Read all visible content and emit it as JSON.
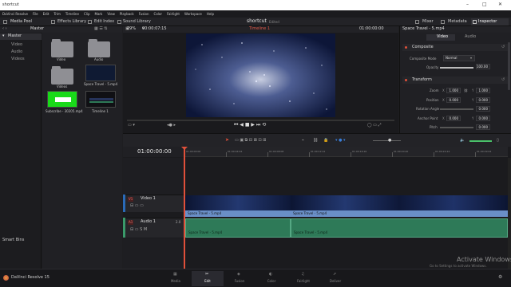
{
  "window": {
    "title": "shortcut"
  },
  "menu": [
    "DaVinci Resolve",
    "File",
    "Edit",
    "Trim",
    "Timeline",
    "Clip",
    "Mark",
    "View",
    "Playback",
    "Fusion",
    "Color",
    "Fairlight",
    "Workspace",
    "Help"
  ],
  "toolbar": {
    "media_pool": "Media Pool",
    "effects_library": "Effects Library",
    "edit_index": "Edit Index",
    "sound_library": "Sound Library",
    "project": "shortcut",
    "project_status": "Edited",
    "mixer": "Mixer",
    "metadata": "Metadata",
    "inspector": "Inspector"
  },
  "sidebar": {
    "items": [
      "Master",
      "Video",
      "Audio",
      "Videos"
    ],
    "smart_bins": "Smart Bins",
    "bin_header": "Master"
  },
  "media": [
    {
      "label": "Video"
    },
    {
      "label": "Audio"
    },
    {
      "label": "Videos"
    },
    {
      "label": "Space Travel - 5.mp4"
    },
    {
      "label": "Subscribe - 30205.mp4"
    },
    {
      "label": "Timeline 1"
    }
  ],
  "viewer": {
    "zoom": "29%",
    "timecode_left": "00:00:07:15",
    "timeline_name": "Timeline 1",
    "timecode_right": "01:00:00:00"
  },
  "inspector": {
    "clip_name": "Space Travel - 5.mp4",
    "tab_video": "Video",
    "tab_audio": "Audio",
    "composite": {
      "title": "Composite",
      "mode_label": "Composite Mode",
      "mode_value": "Normal",
      "opacity_label": "Opacity",
      "opacity_value": "100.00"
    },
    "transform": {
      "title": "Transform",
      "zoom_label": "Zoom",
      "zoom_x_label": "X",
      "zoom_x": "1.000",
      "zoom_y_label": "Y",
      "zoom_y": "1.000",
      "position_label": "Position",
      "pos_x_label": "X",
      "pos_x": "0.000",
      "pos_y_label": "Y",
      "pos_y": "0.000",
      "rotation_label": "Rotation Angle",
      "rotation": "0.000",
      "anchor_label": "Anchor Point",
      "anchor_x_label": "X",
      "anchor_x": "0.000",
      "anchor_y_label": "Y",
      "anchor_y": "0.000",
      "pitch_label": "Pitch",
      "pitch": "0.000"
    }
  },
  "timeline": {
    "timecode": "01:00:00:00",
    "ruler": [
      "01:00:00:00",
      "01:00:04:04",
      "01:00:08:08",
      "01:00:12:12",
      "01:00:16:16",
      "01:00:20:20",
      "01:00:24:24",
      "01:00:29:04"
    ],
    "video_track": {
      "tag": "V1",
      "name": "Video 1",
      "clips": [
        "Space Travel - 5.mp4",
        "Space Travel - 5.mp4"
      ]
    },
    "audio_track": {
      "tag": "A1",
      "name": "Audio 1",
      "level": "2.0",
      "clips": [
        "Space Travel - 5.mp4",
        "Space Travel - 5.mp4"
      ]
    }
  },
  "pages": [
    "Media",
    "Edit",
    "Fusion",
    "Color",
    "Fairlight",
    "Deliver"
  ],
  "active_page": "Edit",
  "app_name": "DaVinci Resolve 15",
  "watermark": {
    "line1": "Activate Windows",
    "line2": "Go to Settings to activate Windows."
  }
}
